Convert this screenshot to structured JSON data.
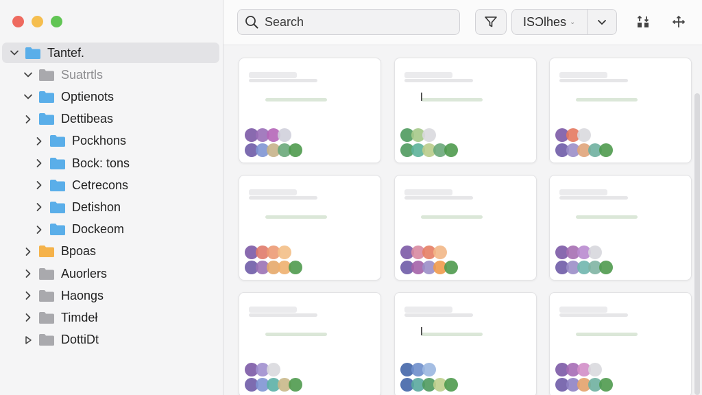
{
  "search": {
    "placeholder": "Search"
  },
  "toolbar": {
    "filter_icon": "funnel-icon",
    "sort_label": "ISƆlhes",
    "sort_caret": "⌄",
    "chevron_icon": "chevron-down-icon",
    "grid_icon": "arrange-icon",
    "move_icon": "move-icon"
  },
  "sidebar": {
    "items": [
      {
        "label": "Tantef.",
        "indent": 0,
        "chevron": "down",
        "folder_color": "#5aaee9",
        "selected": true,
        "dim": false
      },
      {
        "label": "Suatrtls",
        "indent": 1,
        "chevron": "down",
        "folder_color": "#a9a9ad",
        "selected": false,
        "dim": true
      },
      {
        "label": "Optienots",
        "indent": 1,
        "chevron": "down",
        "folder_color": "#5aaee9",
        "selected": false,
        "dim": false
      },
      {
        "label": "Dettibeas",
        "indent": 2,
        "chevron": "right",
        "folder_color": "#5aaee9",
        "selected": false,
        "dim": false
      },
      {
        "label": "Pockhons",
        "indent": 3,
        "chevron": "right",
        "folder_color": "#5aaee9",
        "selected": false,
        "dim": false
      },
      {
        "label": "Bock: tons",
        "indent": 3,
        "chevron": "right",
        "folder_color": "#5aaee9",
        "selected": false,
        "dim": false
      },
      {
        "label": "Cetrecons",
        "indent": 3,
        "chevron": "right",
        "folder_color": "#5aaee9",
        "selected": false,
        "dim": false
      },
      {
        "label": "Detishon",
        "indent": 3,
        "chevron": "right",
        "folder_color": "#5aaee9",
        "selected": false,
        "dim": false
      },
      {
        "label": "Dockeom",
        "indent": 3,
        "chevron": "right",
        "folder_color": "#5aaee9",
        "selected": false,
        "dim": false
      },
      {
        "label": "Bpoas",
        "indent": 2,
        "chevron": "right",
        "folder_color": "#f4b24a",
        "selected": false,
        "dim": false
      },
      {
        "label": "Auorlers",
        "indent": 2,
        "chevron": "right",
        "folder_color": "#a9a9ad",
        "selected": false,
        "dim": false
      },
      {
        "label": "Haongs",
        "indent": 2,
        "chevron": "right",
        "folder_color": "#a9a9ad",
        "selected": false,
        "dim": false
      },
      {
        "label": "Timdeł",
        "indent": 2,
        "chevron": "right",
        "folder_color": "#a9a9ad",
        "selected": false,
        "dim": false
      },
      {
        "label": "DottiDt",
        "indent": 2,
        "chevron": "right-outline",
        "folder_color": "#a9a9ad",
        "selected": false,
        "dim": false
      }
    ]
  },
  "cards": [
    {
      "dots1": [
        "#7c5aa6",
        "#9a6fb8",
        "#b566b8",
        "#d0d0dc"
      ],
      "dots2": [
        "#6f5ca7",
        "#7f95d3",
        "#c6b38a",
        "#6aa87a",
        "#4f9a4e"
      ]
    },
    {
      "dots1": [
        "#4f9a5e",
        "#a5c98a",
        "#d9d9de"
      ],
      "dots2": [
        "#4f9a5e",
        "#5db39a",
        "#b9cc8a",
        "#6aa97a",
        "#4f9a4e"
      ]
    },
    {
      "dots1": [
        "#7c5aa6",
        "#e4795f",
        "#d9d9de"
      ],
      "dots2": [
        "#6f5ca7",
        "#9b8ec8",
        "#e0a47a",
        "#6fb0a0",
        "#4f9a4e"
      ]
    },
    {
      "dots1": [
        "#7c5aa6",
        "#e07a6a",
        "#ec9a74",
        "#f3bf87"
      ],
      "dots2": [
        "#6f5ca7",
        "#9b72b5",
        "#e5a96a",
        "#eeb06f",
        "#4f9a4e"
      ]
    },
    {
      "dots1": [
        "#7c5aa6",
        "#d889a0",
        "#e67e64",
        "#f2b787"
      ],
      "dots2": [
        "#6f5ca7",
        "#a463a8",
        "#9b8ec8",
        "#ef9a4d",
        "#4f9a4e"
      ]
    },
    {
      "dots1": [
        "#7c5aa6",
        "#a66fb3",
        "#b98bcf",
        "#d7d7dd"
      ],
      "dots2": [
        "#6f5ca7",
        "#9b8ec8",
        "#70b6ae",
        "#7fb4a3",
        "#4f9a4e"
      ]
    },
    {
      "dots1": [
        "#7c5aa6",
        "#a08fce",
        "#d9d9de"
      ],
      "dots2": [
        "#6f5ca7",
        "#7f95d3",
        "#5cb0a6",
        "#c9b88a",
        "#4f9a4e"
      ]
    },
    {
      "dots1": [
        "#4466a8",
        "#6e8ecb",
        "#9bb7e0"
      ],
      "dots2": [
        "#4466a8",
        "#5aa89e",
        "#4f9a5e",
        "#bfcf8d",
        "#4f9a4e"
      ]
    },
    {
      "dots1": [
        "#7c5aa6",
        "#a56bb5",
        "#d28ec8",
        "#d9d9de"
      ],
      "dots2": [
        "#6f5ca7",
        "#8f82c3",
        "#e3a26b",
        "#6fb0a0",
        "#4f9a4e"
      ]
    }
  ]
}
